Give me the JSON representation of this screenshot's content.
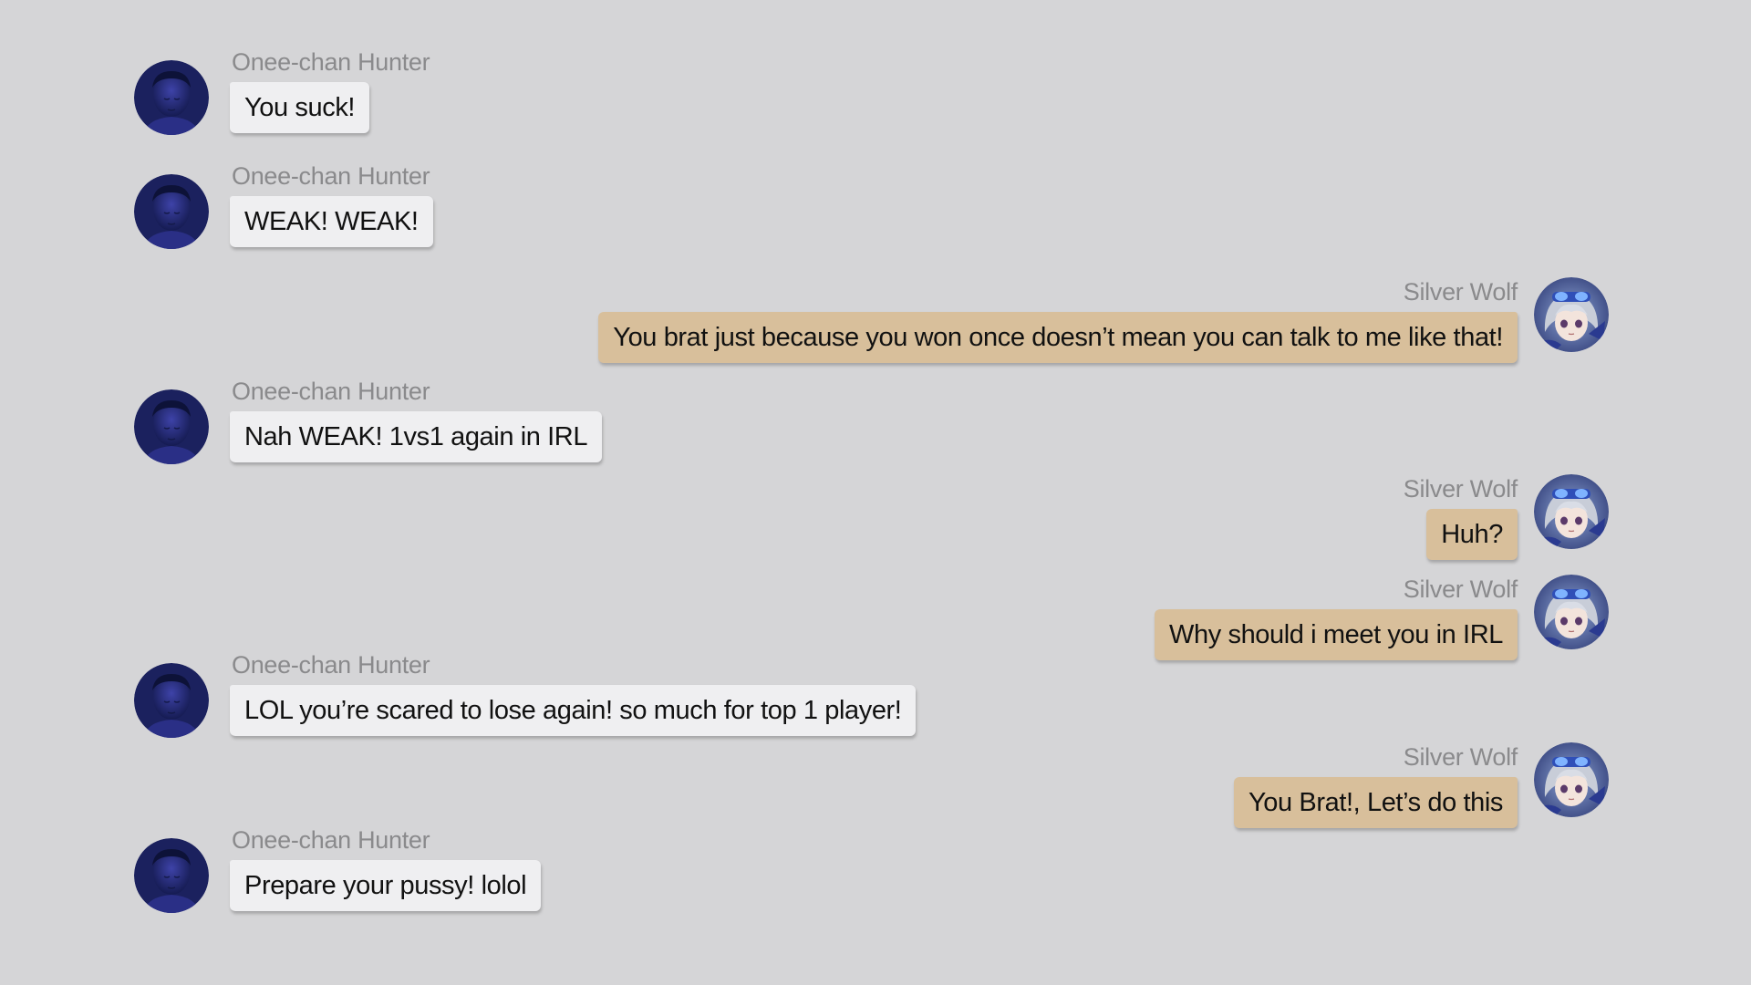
{
  "colors": {
    "background": "#d5d5d7",
    "incoming_bubble": "#efeff1",
    "outgoing_bubble": "#d8bf9b",
    "sender_name": "#8a8a8c",
    "message_text": "#111111"
  },
  "avatars": {
    "onee_chan_hunter": "dark-blue-faceless-avatar-icon",
    "silver_wolf": "silver-haired-anime-girl-avatar-icon"
  },
  "messages": [
    {
      "sender": "Onee-chan Hunter",
      "text": "You suck!"
    },
    {
      "sender": "Onee-chan Hunter",
      "text": "WEAK! WEAK!"
    },
    {
      "sender": "Silver Wolf",
      "text": "You brat just because you won once doesn’t mean you can talk to me like that!"
    },
    {
      "sender": "Onee-chan Hunter",
      "text": "Nah WEAK! 1vs1 again in IRL"
    },
    {
      "sender": "Silver Wolf",
      "text": "Huh?"
    },
    {
      "sender": "Silver Wolf",
      "text": "Why should i meet you in IRL"
    },
    {
      "sender": "Onee-chan Hunter",
      "text": "LOL you’re scared to lose again! so much for top 1 player!"
    },
    {
      "sender": "Silver Wolf",
      "text": "You Brat!, Let’s do this"
    },
    {
      "sender": "Onee-chan Hunter",
      "text": "Prepare your pussy! lolol"
    }
  ]
}
